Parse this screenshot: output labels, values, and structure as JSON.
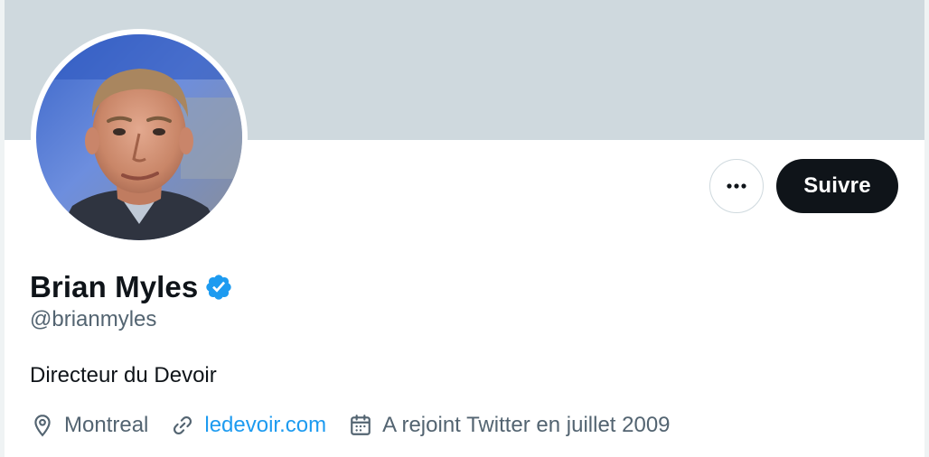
{
  "profile": {
    "name": "Brian Myles",
    "handle": "@brianmyles",
    "bio": "Directeur du Devoir",
    "location": "Montreal",
    "website": "ledevoir.com",
    "joined": "A rejoint Twitter en juillet 2009",
    "verified": true
  },
  "actions": {
    "follow_label": "Suivre",
    "more_icon": "more-horizontal-icon"
  },
  "icons": {
    "location": "location-pin-icon",
    "website": "link-icon",
    "joined": "calendar-icon",
    "verified": "verified-badge-icon"
  },
  "colors": {
    "banner": "#cfd9de",
    "accent": "#1d9bf0",
    "text_primary": "#0f1419",
    "text_secondary": "#536471",
    "follow_bg": "#0f1419"
  }
}
